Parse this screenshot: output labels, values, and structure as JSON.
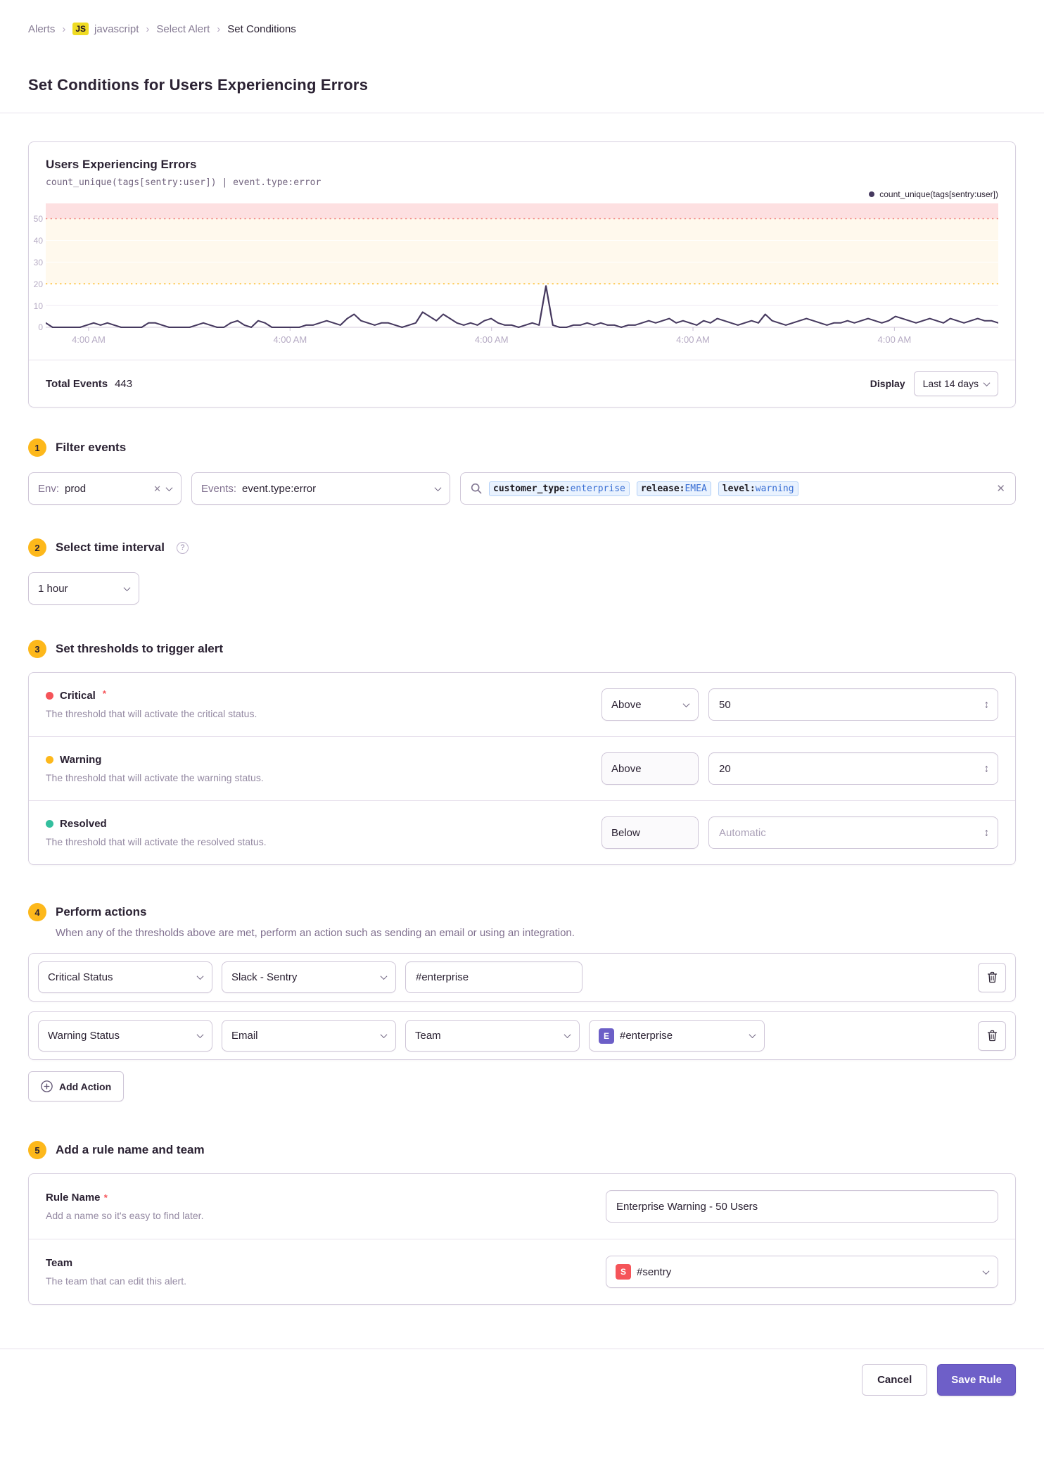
{
  "breadcrumb": {
    "items": [
      {
        "label": "Alerts"
      },
      {
        "label": "javascript",
        "badge": "JS"
      },
      {
        "label": "Select Alert"
      },
      {
        "label": "Set Conditions"
      }
    ],
    "separator": "›"
  },
  "page": {
    "title": "Set Conditions for Users Experiencing Errors"
  },
  "chart_panel": {
    "title": "Users Experiencing Errors",
    "query": "count_unique(tags[sentry:user]) | event.type:error",
    "legend": "count_unique(tags[sentry:user])",
    "total_events_label": "Total Events",
    "total_events_value": "443",
    "display_label": "Display",
    "display_value": "Last 14 days"
  },
  "chart_data": {
    "type": "line",
    "title": "Users Experiencing Errors",
    "series": [
      {
        "name": "count_unique(tags[sentry:user])",
        "values": [
          2,
          0,
          0,
          0,
          0,
          0,
          1,
          2,
          1,
          2,
          1,
          0,
          0,
          0,
          0,
          2,
          2,
          1,
          0,
          0,
          0,
          0,
          1,
          2,
          1,
          0,
          0,
          2,
          3,
          1,
          0,
          3,
          2,
          0,
          0,
          0,
          0,
          0,
          1,
          1,
          2,
          3,
          2,
          1,
          4,
          6,
          3,
          2,
          1,
          2,
          2,
          1,
          0,
          1,
          2,
          7,
          5,
          3,
          6,
          4,
          2,
          1,
          2,
          1,
          3,
          4,
          2,
          1,
          1,
          0,
          1,
          2,
          1,
          19,
          1,
          0,
          0,
          1,
          1,
          2,
          1,
          2,
          1,
          1,
          0,
          1,
          1,
          2,
          3,
          2,
          3,
          4,
          2,
          3,
          2,
          1,
          3,
          2,
          4,
          3,
          2,
          1,
          2,
          3,
          2,
          6,
          3,
          2,
          1,
          2,
          3,
          4,
          3,
          2,
          1,
          2,
          2,
          3,
          2,
          3,
          4,
          3,
          2,
          3,
          5,
          4,
          3,
          2,
          3,
          4,
          3,
          2,
          4,
          3,
          2,
          3,
          4,
          3,
          3,
          2
        ]
      }
    ],
    "x_labels": [
      "4:00 AM",
      "4:00 AM",
      "4:00 AM",
      "4:00 AM",
      "4:00 AM"
    ],
    "x_label_fractions": [
      0.045,
      0.2565,
      0.468,
      0.6795,
      0.891
    ],
    "y_ticks": [
      0,
      10,
      20,
      30,
      40,
      50
    ],
    "ylim": [
      0,
      57
    ],
    "thresholds": {
      "critical": 50,
      "warning": 20
    },
    "colors": {
      "line": "#46395f",
      "critical_band": "rgba(245,84,89,0.18)",
      "critical_line": "#f2908a",
      "warning_band": "rgba(253,184,27,0.08)",
      "warning_line": "#fdb81b",
      "grid_on_white": "#efe9f3",
      "grid_on_band": "#ffffff",
      "baseline": "#d4cbdd",
      "tick": "#cfc6d8"
    },
    "legend_position": "top-right",
    "grid": true
  },
  "filter": {
    "number": "1",
    "title": "Filter events",
    "env_label": "Env:",
    "env_value": "prod",
    "events_label": "Events:",
    "events_value": "event.type:error",
    "search_tokens": [
      {
        "key": "customer_type:",
        "value": "enterprise"
      },
      {
        "key": "release:",
        "value": "EMEA"
      },
      {
        "key": "level:",
        "value": "warning"
      }
    ]
  },
  "interval": {
    "number": "2",
    "title": "Select time interval",
    "help_glyph": "?",
    "value": "1 hour"
  },
  "thresholds": {
    "number": "3",
    "title": "Set thresholds to trigger alert",
    "rows": [
      {
        "name": "Critical",
        "required": "*",
        "dot_color": "#f55459",
        "description": "The threshold that will activate the critical status.",
        "condition": "Above",
        "value": "50"
      },
      {
        "name": "Warning",
        "dot_color": "#fdb81b",
        "description": "The threshold that will activate the warning status.",
        "condition": "Above",
        "value": "20"
      },
      {
        "name": "Resolved",
        "dot_color": "#33bf9e",
        "description": "The threshold that will activate the resolved status.",
        "condition": "Below",
        "placeholder": "Automatic"
      }
    ]
  },
  "actions": {
    "number": "4",
    "title": "Perform actions",
    "description": "When any of the thresholds above are met, perform an action such as sending an email or using an integration.",
    "row1": {
      "status": "Critical Status",
      "service": "Slack - Sentry",
      "target": "#enterprise"
    },
    "row2": {
      "status": "Warning Status",
      "service": "Email",
      "target_type": "Team",
      "team_badge": "E",
      "team_badge_color": "#6c5fc7",
      "team_value": "#enterprise"
    },
    "add_button": "Add Action"
  },
  "rule": {
    "number": "5",
    "title": "Add a rule name and team",
    "name_label": "Rule Name",
    "name_required": "*",
    "name_description": "Add a name so it's easy to find later.",
    "name_value": "Enterprise Warning - 50 Users",
    "team_label": "Team",
    "team_description": "The team that can edit this alert.",
    "team_badge": "S",
    "team_badge_color": "#f55459",
    "team_value": "#sentry"
  },
  "footer": {
    "cancel": "Cancel",
    "save": "Save Rule"
  },
  "glyphs": {
    "close": "✕",
    "stepper": "↕",
    "plus": "+"
  }
}
